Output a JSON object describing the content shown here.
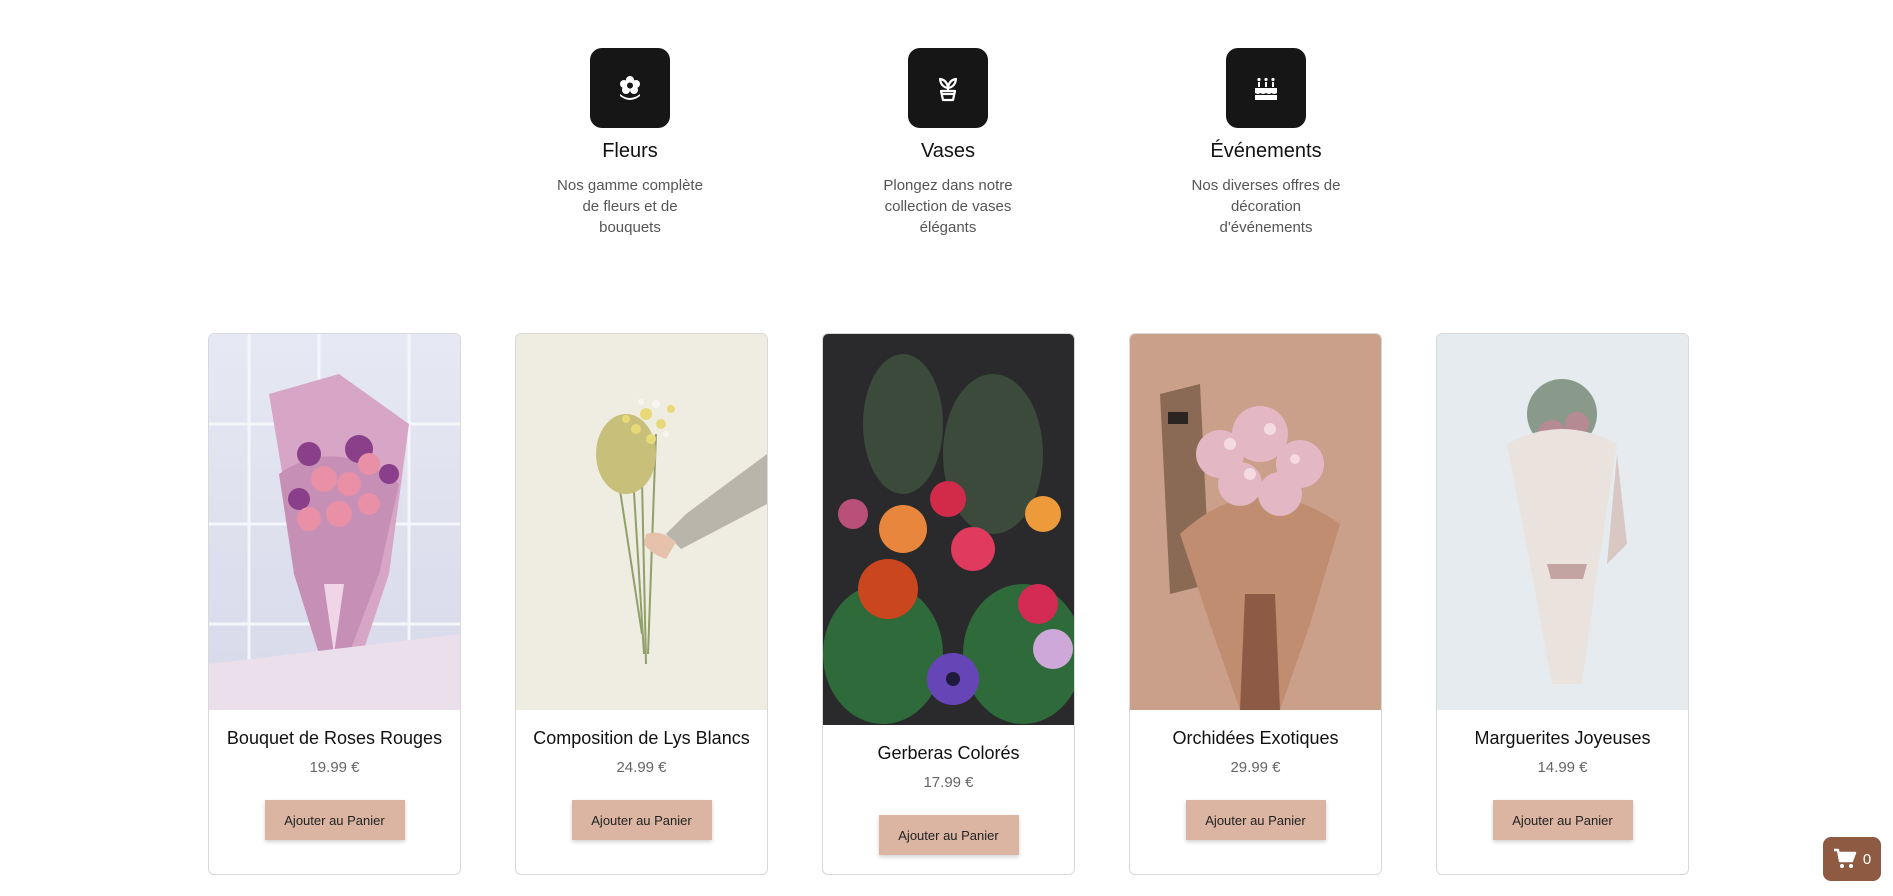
{
  "categories": [
    {
      "icon": "flower-icon",
      "title": "Fleurs",
      "desc": "Nos gamme complète de fleurs et de bouquets"
    },
    {
      "icon": "plant-pot-icon",
      "title": "Vases",
      "desc": "Plongez dans notre collection de vases élégants"
    },
    {
      "icon": "cake-icon",
      "title": "Événements",
      "desc": "Nos diverses offres de décoration d'événements"
    }
  ],
  "products": [
    {
      "name": "Bouquet de Roses Rouges",
      "price": "19.99 €",
      "button": "Ajouter au Panier"
    },
    {
      "name": "Composition de Lys Blancs",
      "price": "24.99 €",
      "button": "Ajouter au Panier"
    },
    {
      "name": "Gerberas Colorés",
      "price": "17.99 €",
      "button": "Ajouter au Panier"
    },
    {
      "name": "Orchidées Exotiques",
      "price": "29.99 €",
      "button": "Ajouter au Panier"
    },
    {
      "name": "Marguerites Joyeuses",
      "price": "14.99 €",
      "button": "Ajouter au Panier"
    }
  ],
  "cart": {
    "count": "0",
    "icon": "cart-icon"
  },
  "colors": {
    "button": "#dbb5a2",
    "cart": "#8e5a41",
    "icon_tile": "#161616"
  }
}
